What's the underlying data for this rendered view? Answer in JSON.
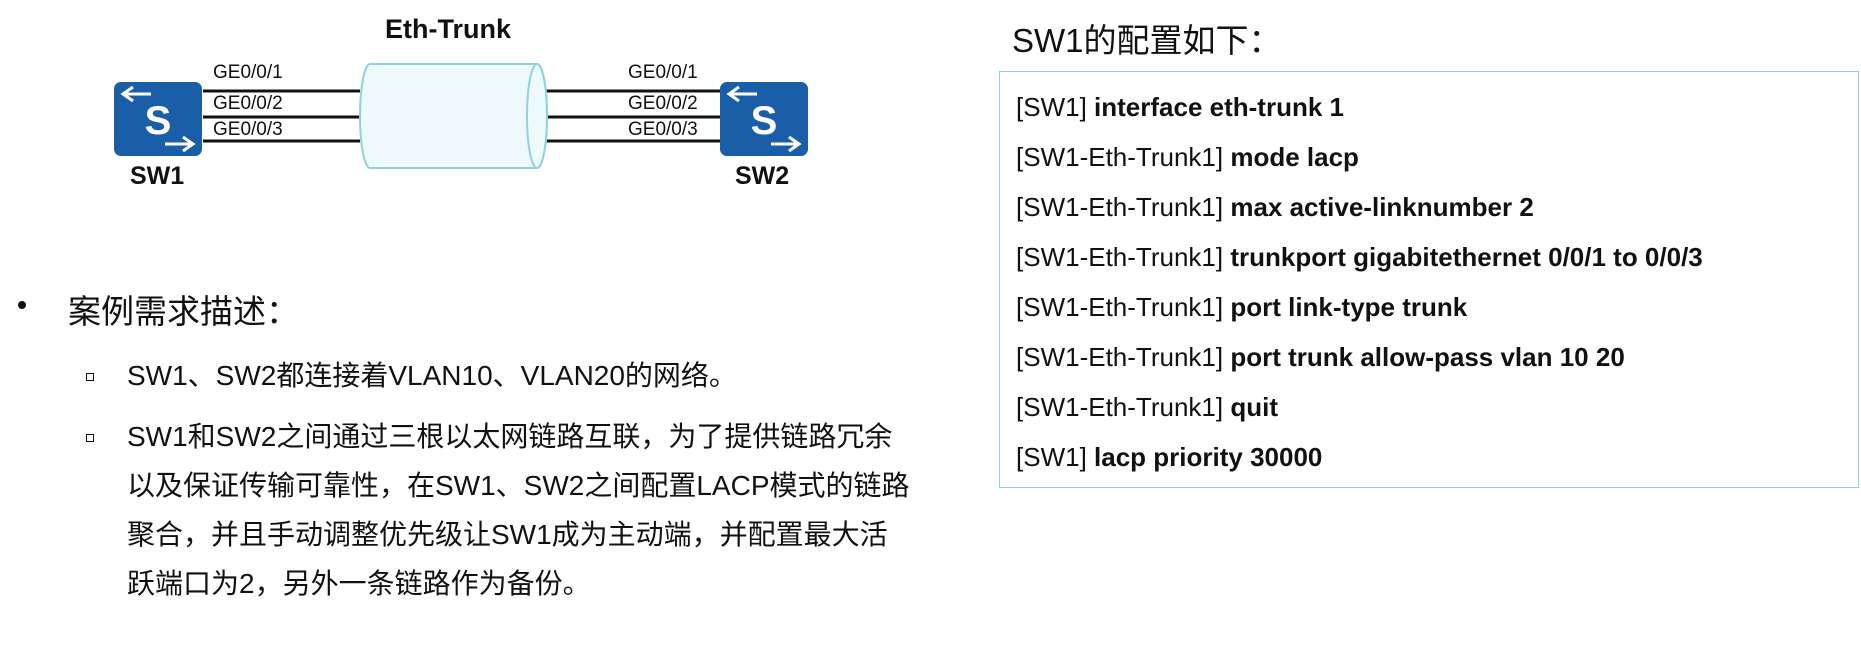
{
  "diagram": {
    "trunk_label": "Eth-Trunk",
    "sw1_label": "SW1",
    "sw2_label": "SW2",
    "switch_glyph": "S",
    "sw1_ports": [
      "GE0/0/1",
      "GE0/0/2",
      "GE0/0/3"
    ],
    "sw2_ports": [
      "GE0/0/1",
      "GE0/0/2",
      "GE0/0/3"
    ],
    "colors": {
      "switch": "#1a5ea8",
      "trunk_fill": "#eef9fc",
      "trunk_stroke": "#8fd1dc"
    }
  },
  "requirements": {
    "title": "案例需求描述：",
    "items": [
      [
        "SW1、SW2都连接着VLAN10、VLAN20的网络。"
      ],
      [
        "SW1和SW2之间通过三根以太网链路互联，为了提供链路冗余",
        "以及保证传输可靠性，在SW1、SW2之间配置LACP模式的链路",
        "聚合，并且手动调整优先级让SW1成为主动端，并配置最大活",
        "跃端口为2，另外一条链路作为备份。"
      ]
    ]
  },
  "config": {
    "title": "SW1的配置如下：",
    "lines": [
      {
        "prompt": "[SW1]",
        "command": "interface eth-trunk 1"
      },
      {
        "prompt": "[SW1-Eth-Trunk1]",
        "command": "mode lacp"
      },
      {
        "prompt": "[SW1-Eth-Trunk1]",
        "command": "max active-linknumber 2"
      },
      {
        "prompt": "[SW1-Eth-Trunk1]",
        "command": "trunkport gigabitethernet 0/0/1 to 0/0/3"
      },
      {
        "prompt": "[SW1-Eth-Trunk1]",
        "command": "port link-type trunk"
      },
      {
        "prompt": "[SW1-Eth-Trunk1]",
        "command": "port trunk allow-pass vlan 10 20"
      },
      {
        "prompt": "[SW1-Eth-Trunk1]",
        "command": "quit"
      },
      {
        "prompt": "[SW1]",
        "command": "lacp priority 30000"
      }
    ]
  }
}
